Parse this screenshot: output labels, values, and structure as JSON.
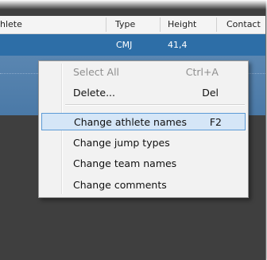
{
  "table": {
    "columns": [
      {
        "label": "hlete"
      },
      {
        "label": "Type"
      },
      {
        "label": "Height"
      },
      {
        "label": "Contact"
      }
    ],
    "rows": [
      {
        "athlete": "",
        "type": "CMJ",
        "height": "41,4",
        "contact": ""
      }
    ]
  },
  "context_menu": {
    "items": [
      {
        "label": "Select All",
        "shortcut": "Ctrl+A",
        "enabled": false
      },
      {
        "label": "Delete...",
        "shortcut": "Del",
        "enabled": true
      },
      {
        "label": "Change athlete names",
        "shortcut": "F2",
        "enabled": true,
        "highlighted": true
      },
      {
        "label": "Change jump types",
        "shortcut": "",
        "enabled": true
      },
      {
        "label": "Change team names",
        "shortcut": "",
        "enabled": true
      },
      {
        "label": "Change comments",
        "shortcut": "",
        "enabled": true
      }
    ]
  },
  "colors": {
    "selection_row": "#2d6ea7",
    "menu_highlight": "#d5e6f7",
    "menu_highlight_border": "#5c9ad6",
    "empty_area": "#3f3f3f"
  }
}
